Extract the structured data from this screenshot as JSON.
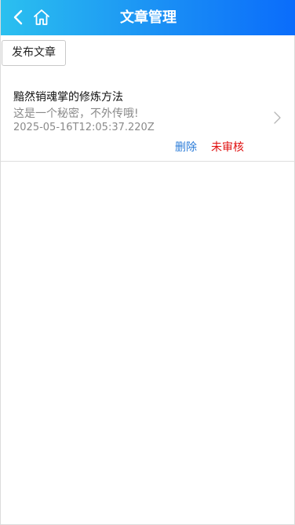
{
  "header": {
    "title": "文章管理",
    "back_icon": "chevron-left-icon",
    "home_icon": "home-icon",
    "gradient_start": "#2bc0ef",
    "gradient_end": "#0a6cfb"
  },
  "toolbar": {
    "publish_label": "发布文章"
  },
  "articles": [
    {
      "title": "黯然销魂掌的修炼方法",
      "description": "这是一个秘密，不外传哦!",
      "created_at": "2025-05-16T12:05:37.220Z",
      "delete_label": "删除",
      "status": "未审核",
      "status_color": "#e01010",
      "chevron_icon": "chevron-right-icon"
    }
  ]
}
